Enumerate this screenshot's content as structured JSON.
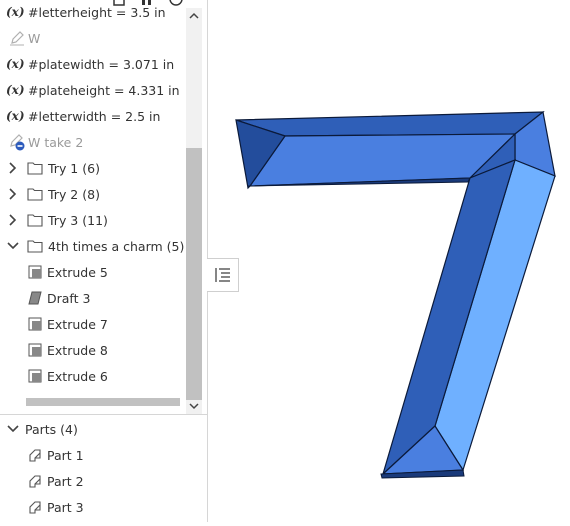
{
  "features": {
    "rows": [
      {
        "kind": "var",
        "text": "#letterheight = 3.5 in"
      },
      {
        "kind": "sketch",
        "text": "W"
      },
      {
        "kind": "var",
        "text": "#platewidth = 3.071 in"
      },
      {
        "kind": "var",
        "text": "#plateheight = 4.331 in"
      },
      {
        "kind": "var",
        "text": "#letterwidth = 2.5 in"
      },
      {
        "kind": "sketch-error",
        "text": "W take 2"
      },
      {
        "kind": "folder",
        "text": "Try 1 (6)"
      },
      {
        "kind": "folder",
        "text": "Try 2 (8)"
      },
      {
        "kind": "folder",
        "text": "Try 3 (11)"
      },
      {
        "kind": "folder-open",
        "text": "4th times a charm (5)"
      },
      {
        "kind": "extrude",
        "text": "Extrude 5"
      },
      {
        "kind": "draft",
        "text": "Draft 3"
      },
      {
        "kind": "extrude",
        "text": "Extrude 7"
      },
      {
        "kind": "extrude",
        "text": "Extrude 8"
      },
      {
        "kind": "extrude",
        "text": "Extrude 6"
      }
    ]
  },
  "parts": {
    "header": "Parts (4)",
    "items": [
      "Part 1",
      "Part 2",
      "Part 3"
    ]
  },
  "viewport": {
    "model": "7",
    "colors": {
      "dark": "#2f5fb8",
      "mid": "#4a7fe0",
      "light": "#6fb0ff",
      "edge": "#0b1a3a"
    }
  }
}
